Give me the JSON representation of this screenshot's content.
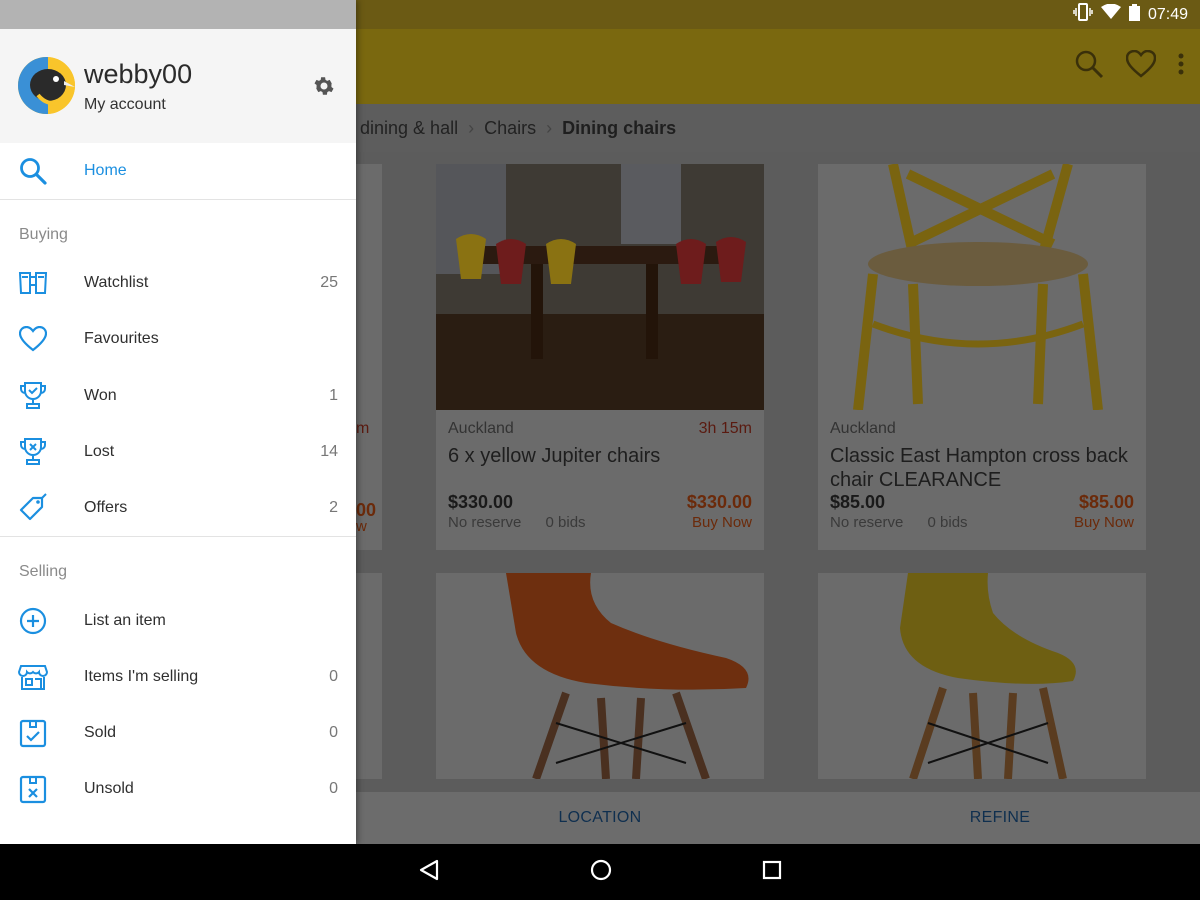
{
  "status_bar": {
    "time": "07:49"
  },
  "breadcrumb": {
    "items": [
      "e, dining & hall",
      "Chairs"
    ],
    "current": "Dining chairs"
  },
  "listings": [
    {
      "location": "Auckland",
      "timer": "3h 15m",
      "title": "6 x yellow Jupiter chairs",
      "price": "$330.00",
      "reserve": "No reserve",
      "bids": "0 bids",
      "buy_price": "$330.00",
      "buy_label": "Buy Now"
    },
    {
      "location": "Auckland",
      "timer": "",
      "title": "Classic East Hampton cross back chair CLEARANCE",
      "price": "$85.00",
      "reserve": "No reserve",
      "bids": "0 bids",
      "buy_price": "$85.00",
      "buy_label": "Buy Now"
    }
  ],
  "peek": {
    "timer_fragment": "m",
    "price_fragment": "00",
    "buy_fragment": "w"
  },
  "bottom_bar": {
    "location": "LOCATION",
    "refine": "REFINE"
  },
  "drawer": {
    "user": {
      "name": "webby00",
      "sub": "My account"
    },
    "home": "Home",
    "buying_label": "Buying",
    "buying": [
      {
        "label": "Watchlist",
        "count": "25",
        "icon": "binoculars-icon"
      },
      {
        "label": "Favourites",
        "count": "",
        "icon": "heart-icon"
      },
      {
        "label": "Won",
        "count": "1",
        "icon": "trophy-check-icon"
      },
      {
        "label": "Lost",
        "count": "14",
        "icon": "trophy-x-icon"
      },
      {
        "label": "Offers",
        "count": "2",
        "icon": "price-tag-icon"
      }
    ],
    "selling_label": "Selling",
    "selling": [
      {
        "label": "List an item",
        "count": "",
        "icon": "plus-circle-icon"
      },
      {
        "label": "Items I'm selling",
        "count": "0",
        "icon": "storefront-icon"
      },
      {
        "label": "Sold",
        "count": "0",
        "icon": "box-check-icon"
      },
      {
        "label": "Unsold",
        "count": "0",
        "icon": "box-x-icon"
      }
    ]
  },
  "colors": {
    "accent_blue": "#1b8fe0",
    "brand_yellow": "#f9c52b",
    "price_red": "#e0501d"
  }
}
